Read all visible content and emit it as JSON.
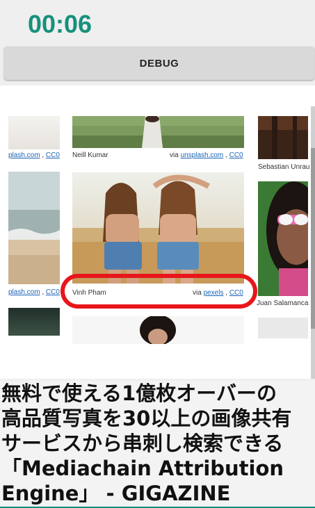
{
  "timer": "00:06",
  "debug_button": "DEBUG",
  "gallery": {
    "left_col": [
      {
        "via_text": "plash.com",
        "sep": " , ",
        "license": "CC0"
      },
      {
        "via_text": "plash.com",
        "sep": " , ",
        "license": "CC0"
      }
    ],
    "center_top": {
      "author": "Neill Kumar",
      "via_prefix": "via ",
      "site": "unsplash.com",
      "sep": " , ",
      "license": "CC0"
    },
    "center_main": {
      "author": "Vinh Pham",
      "via_prefix": "via ",
      "site": "pexels",
      "sep": " , ",
      "license": "CC0"
    },
    "right_col": [
      {
        "author": "Sebastian Unrau"
      },
      {
        "author": "Juan Salamanca"
      }
    ]
  },
  "headline": {
    "line1": "無料で使える1億枚オーバーの",
    "line2": "高品質写真を30以上の画像共有",
    "line3": "サービスから串刺し検索できる",
    "line4": "「Mediachain Attribution",
    "line5": "Engine」 - GIGAZINE"
  },
  "colors": {
    "timer": "#16907c",
    "highlight": "#e8161b",
    "link": "#1a63b5"
  }
}
